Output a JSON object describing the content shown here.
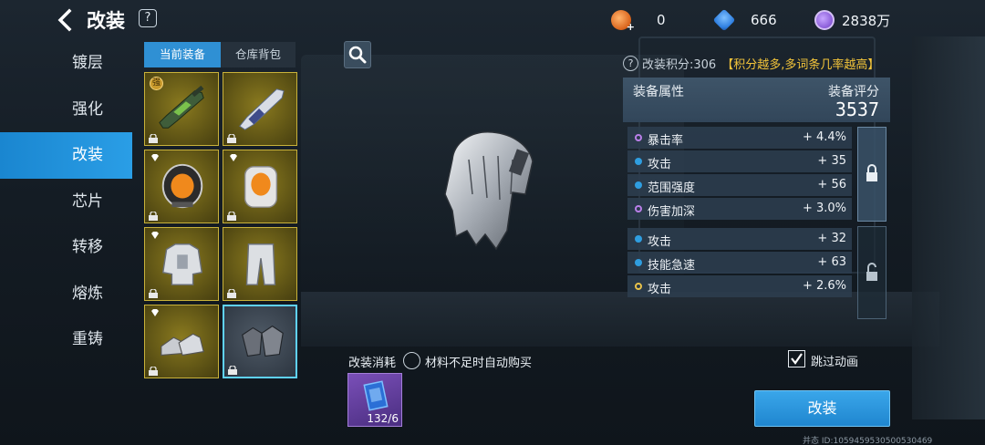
{
  "header": {
    "title": "改装",
    "help_glyph": "?",
    "currencies": [
      {
        "icon": "fire-crystal-icon",
        "value": "0",
        "color": "#e67a2a"
      },
      {
        "icon": "blue-gem-icon",
        "value": "666",
        "color": "#2f7fe0"
      },
      {
        "icon": "purple-coin-icon",
        "value": "2838万",
        "color": "#8a5cd8"
      }
    ]
  },
  "sidebar": {
    "items": [
      {
        "label": "镀层"
      },
      {
        "label": "强化"
      },
      {
        "label": "改装"
      },
      {
        "label": "芯片"
      },
      {
        "label": "转移"
      },
      {
        "label": "熔炼"
      },
      {
        "label": "重铸"
      }
    ],
    "active": "改装"
  },
  "tabs": [
    {
      "label": "当前装备"
    },
    {
      "label": "仓库背包"
    }
  ],
  "equipment": [
    {
      "name": "rifle",
      "badge": "强"
    },
    {
      "name": "cannon"
    },
    {
      "name": "helmet"
    },
    {
      "name": "backpack"
    },
    {
      "name": "armor"
    },
    {
      "name": "pants"
    },
    {
      "name": "boots"
    },
    {
      "name": "gloves"
    }
  ],
  "score": {
    "label": "改装积分:306",
    "hint": "【积分越多,多词条几率越高】"
  },
  "attributes": {
    "title": "装备属性",
    "rating_label": "装备评分",
    "rating_value": "3537",
    "locked_group": [
      {
        "name": "暴击率",
        "value": "+ 4.4%",
        "marker": "purple-ring"
      },
      {
        "name": "攻击",
        "value": "+ 35",
        "marker": "blue-dot"
      },
      {
        "name": "范围强度",
        "value": "+ 56",
        "marker": "blue-dot"
      },
      {
        "name": "伤害加深",
        "value": "+ 3.0%",
        "marker": "purple-ring"
      }
    ],
    "unlocked_group": [
      {
        "name": "攻击",
        "value": "+ 32",
        "marker": "blue-dot"
      },
      {
        "name": "技能急速",
        "value": "+ 63",
        "marker": "blue-dot"
      },
      {
        "name": "攻击",
        "value": "+ 2.6%",
        "marker": "gold-ring"
      }
    ]
  },
  "bottom": {
    "cost_label": "改装消耗",
    "auto_buy_label": "材料不足时自动购买",
    "material_count": "132/6",
    "skip_label": "跳过动画",
    "action_label": "改装",
    "footer": "并态 ID:10594595305005304​69"
  }
}
